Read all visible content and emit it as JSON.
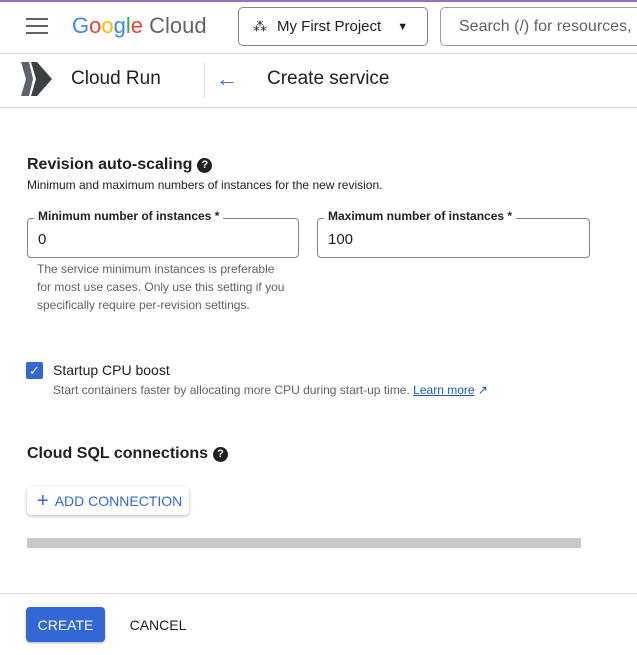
{
  "header": {
    "logo_text": "Google Cloud",
    "project": "My First Project",
    "search_placeholder": "Search (/) for resources,"
  },
  "subheader": {
    "product": "Cloud Run",
    "page_title": "Create service"
  },
  "autoscaling": {
    "title": "Revision auto-scaling",
    "description": "Minimum and maximum numbers of instances for the new revision.",
    "min_label": "Minimum number of instances *",
    "min_value": "0",
    "max_label": "Maximum number of instances *",
    "max_value": "100",
    "hint": "The service minimum instances is preferable for most use cases. Only use this setting if you specifically require per-revision settings."
  },
  "cpu_boost": {
    "label": "Startup CPU boost",
    "checked": true,
    "description": "Start containers faster by allocating more CPU during start-up time.",
    "learn_more": "Learn more"
  },
  "sql": {
    "title": "Cloud SQL connections",
    "add_button": "ADD CONNECTION"
  },
  "footer": {
    "create": "CREATE",
    "cancel": "CANCEL"
  },
  "colors": {
    "accent": "#3367d6",
    "top_line": "#9c6bc4"
  }
}
